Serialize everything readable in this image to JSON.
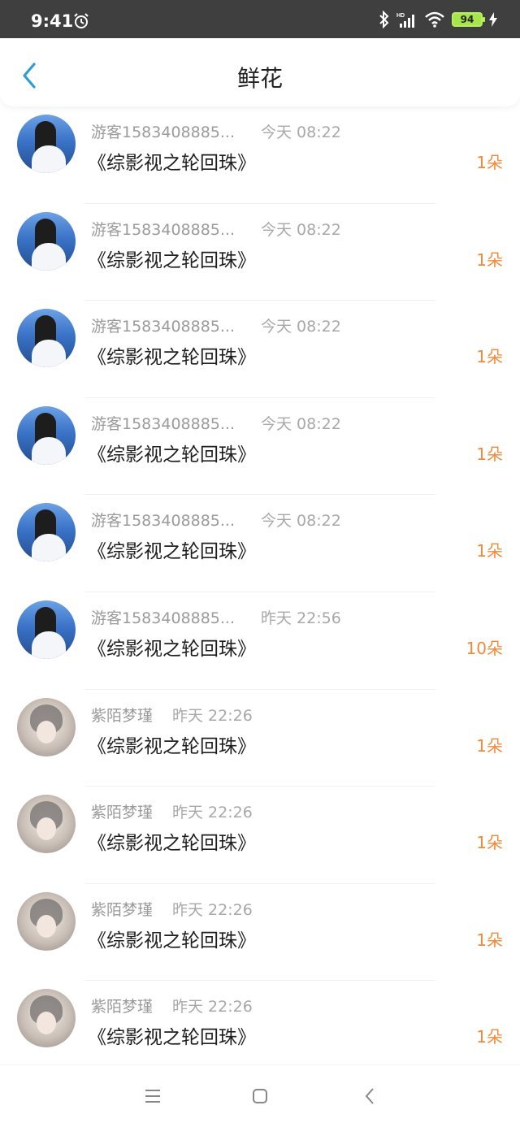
{
  "status_bar": {
    "time": "9:41",
    "battery": "94",
    "icons": [
      "alarm-icon",
      "bluetooth-icon",
      "signal-hd-icon",
      "wifi-icon",
      "battery-icon",
      "charging-icon"
    ]
  },
  "header": {
    "title": "鲜花",
    "back_icon": "chevron-left-icon"
  },
  "colors": {
    "accent": "#2d9cdb",
    "count": "#f08a3a",
    "status_bar": "#3f3f3f",
    "battery": "#a7e64a"
  },
  "rows": [
    {
      "avatar": "sea",
      "name": "游客1583408885...",
      "time": "今天 08:22",
      "book": "《综影视之轮回珠》",
      "count": "1朵"
    },
    {
      "avatar": "sea",
      "name": "游客1583408885...",
      "time": "今天 08:22",
      "book": "《综影视之轮回珠》",
      "count": "1朵"
    },
    {
      "avatar": "sea",
      "name": "游客1583408885...",
      "time": "今天 08:22",
      "book": "《综影视之轮回珠》",
      "count": "1朵"
    },
    {
      "avatar": "sea",
      "name": "游客1583408885...",
      "time": "今天 08:22",
      "book": "《综影视之轮回珠》",
      "count": "1朵"
    },
    {
      "avatar": "sea",
      "name": "游客1583408885...",
      "time": "今天 08:22",
      "book": "《综影视之轮回珠》",
      "count": "1朵"
    },
    {
      "avatar": "sea",
      "name": "游客1583408885...",
      "time": "昨天 22:56",
      "book": "《综影视之轮回珠》",
      "count": "10朵"
    },
    {
      "avatar": "ink",
      "name": "紫陌梦瑾",
      "time": "昨天 22:26",
      "book": "《综影视之轮回珠》",
      "count": "1朵"
    },
    {
      "avatar": "ink",
      "name": "紫陌梦瑾",
      "time": "昨天 22:26",
      "book": "《综影视之轮回珠》",
      "count": "1朵"
    },
    {
      "avatar": "ink",
      "name": "紫陌梦瑾",
      "time": "昨天 22:26",
      "book": "《综影视之轮回珠》",
      "count": "1朵"
    },
    {
      "avatar": "ink",
      "name": "紫陌梦瑾",
      "time": "昨天 22:26",
      "book": "《综影视之轮回珠》",
      "count": "1朵"
    }
  ],
  "nav_bar": {
    "icons": [
      "menu-icon",
      "home-square-icon",
      "back-chevron-icon"
    ]
  }
}
